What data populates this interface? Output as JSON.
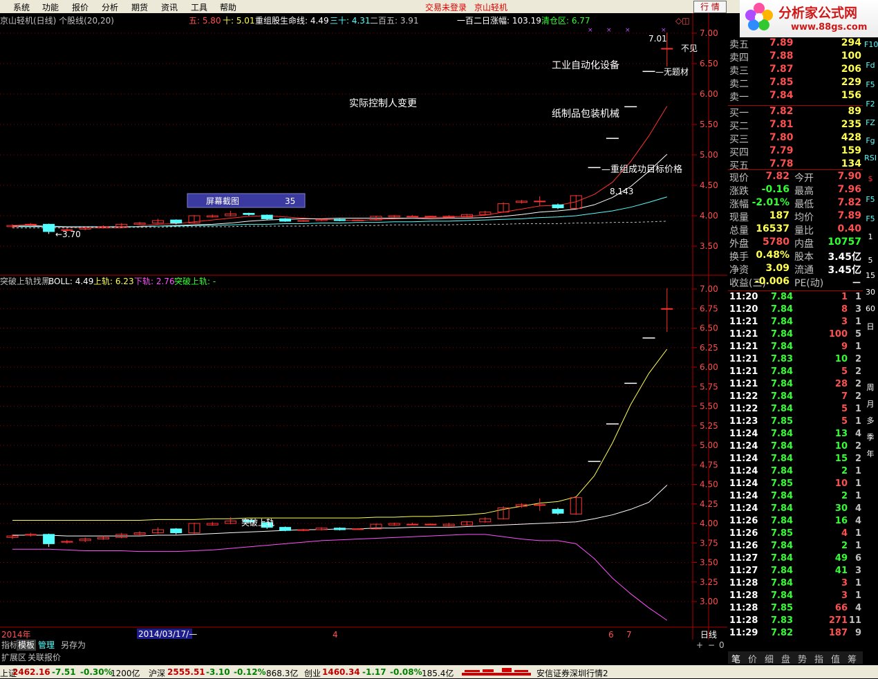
{
  "menu": {
    "items": [
      "系统",
      "功能",
      "报价",
      "分析",
      "期货",
      "资讯",
      "工具",
      "帮助"
    ],
    "login_status": "交易未登录",
    "stock_title": "京山轻机",
    "quote_button": "行 情"
  },
  "logo": {
    "text": "分析家公式网",
    "url": "www.88gs.com"
  },
  "top_panel": {
    "title": "京山轻机(日线) 个股线(20,20)",
    "ma5_label": "五: 5.80",
    "ma10_label": "十: 5.01",
    "line_label": "重组股生命线: 4.49",
    "ma30_label": "三十: 4.31",
    "ma250_label": "二百五: 3.91",
    "rise120": "一百二日涨幅: 103.19",
    "clear_zone": "清仓区: 6.77",
    "annotations": [
      "工业自动化设备",
      "实际控制人变更",
      "纸制品包装机械",
      "—重组成功目标价格",
      "—无题材",
      "不见"
    ],
    "high_label": "7.01",
    "low_label": "←3.70",
    "target_label": "8.143",
    "popup_label": "屏幕截图",
    "popup_value": "35",
    "axis_ticks": [
      "7.00",
      "6.50",
      "6.00",
      "5.50",
      "5.00",
      "4.50",
      "4.00",
      "3.50"
    ]
  },
  "bottom_panel": {
    "title": "突破上轨找黑",
    "boll_label": "BOLL: 4.49",
    "upper_label": "上轨: 6.23",
    "lower_label": "下轨: 2.76",
    "break_label": "突破上轨: -",
    "mark_text": "突破上轨",
    "axis_ticks": [
      "7.00",
      "6.75",
      "6.50",
      "6.25",
      "6.00",
      "5.75",
      "5.50",
      "5.25",
      "5.00",
      "4.75",
      "4.50",
      "4.25",
      "4.00",
      "3.75",
      "3.50",
      "3.25",
      "3.00"
    ]
  },
  "date_axis": {
    "year": "2014年",
    "cursor_date": "2014/03/17/—",
    "m4": "4",
    "m6": "6",
    "m7": "7",
    "period": "日线"
  },
  "bottom_tabs": [
    "指标",
    "模板",
    "管理",
    "另存为"
  ],
  "bottom_tabs2": [
    "扩展区",
    "关联报价"
  ],
  "zoom_controls": [
    "+",
    "−",
    "0"
  ],
  "quote": {
    "asks": [
      {
        "label": "卖五",
        "price": "7.89",
        "vol": "294"
      },
      {
        "label": "卖四",
        "price": "7.88",
        "vol": "100"
      },
      {
        "label": "卖三",
        "price": "7.87",
        "vol": "206"
      },
      {
        "label": "卖二",
        "price": "7.85",
        "vol": "229"
      },
      {
        "label": "卖一",
        "price": "7.84",
        "vol": "156"
      }
    ],
    "bids": [
      {
        "label": "买一",
        "price": "7.82",
        "vol": "89"
      },
      {
        "label": "买二",
        "price": "7.81",
        "vol": "235"
      },
      {
        "label": "买三",
        "price": "7.80",
        "vol": "428"
      },
      {
        "label": "买四",
        "price": "7.79",
        "vol": "159"
      },
      {
        "label": "买五",
        "price": "7.78",
        "vol": "134"
      }
    ],
    "stats": [
      {
        "l1": "现价",
        "v1": "7.82",
        "l2": "今开",
        "v2": "7.90"
      },
      {
        "l1": "涨跌",
        "v1": "-0.16",
        "l2": "最高",
        "v2": "7.96"
      },
      {
        "l1": "涨幅",
        "v1": "-2.01%",
        "l2": "最低",
        "v2": "7.82"
      },
      {
        "l1": "现量",
        "v1": "187",
        "l2": "均价",
        "v2": "7.89"
      },
      {
        "l1": "总量",
        "v1": "16537",
        "l2": "量比",
        "v2": "0.40"
      },
      {
        "l1": "外盘",
        "v1": "5780",
        "l2": "内盘",
        "v2": "10757"
      },
      {
        "l1": "换手",
        "v1": "0.48%",
        "l2": "股本",
        "v2": "3.45亿"
      },
      {
        "l1": "净资",
        "v1": "3.09",
        "l2": "流通",
        "v2": "3.45亿"
      },
      {
        "l1": "收益(三)",
        "v1": "-0.006",
        "l2": "PE(动)",
        "v2": "－"
      }
    ]
  },
  "trades": [
    [
      "11:20",
      "7.84",
      "1",
      "1"
    ],
    [
      "11:20",
      "7.84",
      "8",
      "3"
    ],
    [
      "11:21",
      "7.84",
      "3",
      "1"
    ],
    [
      "11:21",
      "7.84",
      "100",
      "5"
    ],
    [
      "11:21",
      "7.84",
      "9",
      "1"
    ],
    [
      "11:21",
      "7.83",
      "10",
      "2"
    ],
    [
      "11:21",
      "7.84",
      "5",
      "2"
    ],
    [
      "11:21",
      "7.84",
      "28",
      "2"
    ],
    [
      "11:22",
      "7.84",
      "7",
      "2"
    ],
    [
      "11:22",
      "7.84",
      "5",
      "1"
    ],
    [
      "11:23",
      "7.85",
      "5",
      "1"
    ],
    [
      "11:24",
      "7.84",
      "13",
      "4"
    ],
    [
      "11:24",
      "7.84",
      "10",
      "2"
    ],
    [
      "11:24",
      "7.84",
      "15",
      "2"
    ],
    [
      "11:24",
      "7.84",
      "2",
      "1"
    ],
    [
      "11:24",
      "7.85",
      "10",
      "1"
    ],
    [
      "11:24",
      "7.84",
      "2",
      "1"
    ],
    [
      "11:24",
      "7.84",
      "30",
      "4"
    ],
    [
      "11:26",
      "7.84",
      "16",
      "4"
    ],
    [
      "11:26",
      "7.85",
      "4",
      "1"
    ],
    [
      "11:26",
      "7.84",
      "2",
      "1"
    ],
    [
      "11:27",
      "7.84",
      "49",
      "6"
    ],
    [
      "11:27",
      "7.84",
      "41",
      "3"
    ],
    [
      "11:28",
      "7.84",
      "3",
      "1"
    ],
    [
      "11:28",
      "7.84",
      "3",
      "1"
    ],
    [
      "11:28",
      "7.85",
      "66",
      "4"
    ],
    [
      "11:28",
      "7.83",
      "271",
      "11"
    ],
    [
      "11:29",
      "7.82",
      "187",
      "9"
    ]
  ],
  "right_tabs": [
    "笔",
    "价",
    "细",
    "盘",
    "势",
    "指",
    "值",
    "筹"
  ],
  "side_tools": [
    "F10",
    "Fd",
    "F5",
    "F2",
    "FZ",
    "Fg",
    "RSI",
    "$",
    "F5",
    "F5",
    "1",
    "5",
    "15",
    "30",
    "60",
    "日",
    "周",
    "月",
    "多",
    "季",
    "年"
  ],
  "status": {
    "sh_label": "上证",
    "sh_val": "2462.16",
    "sh_chg": "-7.51",
    "sh_pct": "-0.30%",
    "sh_amt": "1200亿",
    "hs_label": "沪深",
    "hs_val": "2555.51",
    "hs_chg": "-3.10",
    "hs_pct": "-0.12%",
    "hs_amt": "868.3亿",
    "cy_label": "创业",
    "cy_val": "1460.34",
    "cy_chg": "-1.17",
    "cy_pct": "-0.08%",
    "cy_amt": "185.4亿",
    "broker": "安信证券深圳行情2"
  },
  "colors": {
    "up": "#ff3232",
    "down": "#54ffff",
    "bg": "#000000",
    "grid": "#8b0000",
    "ma5": "#ffffff",
    "ma10": "#ffff00",
    "ma30": "#ff00ff"
  },
  "chart_data": [
    {
      "type": "candlestick",
      "title": "京山轻机(日线) 个股线(20,20)",
      "ylim": [
        3.3,
        7.2
      ],
      "candles": [
        {
          "o": 3.82,
          "c": 3.84,
          "h": 3.86,
          "l": 3.8
        },
        {
          "o": 3.85,
          "c": 3.86,
          "h": 3.88,
          "l": 3.83
        },
        {
          "o": 3.86,
          "c": 3.74,
          "h": 3.87,
          "l": 3.7
        },
        {
          "o": 3.76,
          "c": 3.77,
          "h": 3.79,
          "l": 3.74
        },
        {
          "o": 3.78,
          "c": 3.8,
          "h": 3.82,
          "l": 3.76
        },
        {
          "o": 3.8,
          "c": 3.82,
          "h": 3.84,
          "l": 3.79
        },
        {
          "o": 3.82,
          "c": 3.86,
          "h": 3.88,
          "l": 3.81
        },
        {
          "o": 3.86,
          "c": 3.88,
          "h": 3.9,
          "l": 3.85
        },
        {
          "o": 3.88,
          "c": 3.92,
          "h": 3.95,
          "l": 3.87
        },
        {
          "o": 3.93,
          "c": 3.88,
          "h": 3.94,
          "l": 3.86
        },
        {
          "o": 3.88,
          "c": 4.0,
          "h": 4.01,
          "l": 3.87
        },
        {
          "o": 3.98,
          "c": 4.0,
          "h": 4.02,
          "l": 3.97
        },
        {
          "o": 4.0,
          "c": 4.03,
          "h": 4.08,
          "l": 3.99
        },
        {
          "o": 4.04,
          "c": 4.02,
          "h": 4.05,
          "l": 4.0
        },
        {
          "o": 4.01,
          "c": 3.95,
          "h": 4.02,
          "l": 3.93
        },
        {
          "o": 3.95,
          "c": 3.91,
          "h": 3.96,
          "l": 3.9
        },
        {
          "o": 3.91,
          "c": 3.92,
          "h": 3.93,
          "l": 3.9
        },
        {
          "o": 3.92,
          "c": 3.94,
          "h": 3.95,
          "l": 3.91
        },
        {
          "o": 3.94,
          "c": 3.92,
          "h": 3.95,
          "l": 3.91
        },
        {
          "o": 3.93,
          "c": 3.93,
          "h": 3.94,
          "l": 3.92
        },
        {
          "o": 3.93,
          "c": 3.99,
          "h": 4.0,
          "l": 3.92
        },
        {
          "o": 3.98,
          "c": 4.0,
          "h": 4.01,
          "l": 3.97
        },
        {
          "o": 3.99,
          "c": 3.99,
          "h": 4.01,
          "l": 3.98
        },
        {
          "o": 3.99,
          "c": 3.99,
          "h": 4.0,
          "l": 3.98
        },
        {
          "o": 3.97,
          "c": 3.99,
          "h": 4.01,
          "l": 3.96
        },
        {
          "o": 3.98,
          "c": 4.02,
          "h": 4.03,
          "l": 3.97
        },
        {
          "o": 4.02,
          "c": 4.06,
          "h": 4.08,
          "l": 4.01
        },
        {
          "o": 4.06,
          "c": 4.2,
          "h": 4.22,
          "l": 4.05
        },
        {
          "o": 4.22,
          "c": 4.24,
          "h": 4.26,
          "l": 4.2
        },
        {
          "o": 4.24,
          "c": 4.24,
          "h": 4.32,
          "l": 4.16
        },
        {
          "o": 4.18,
          "c": 4.13,
          "h": 4.2,
          "l": 4.11
        },
        {
          "o": 4.12,
          "c": 4.33,
          "h": 4.34,
          "l": 4.11
        },
        {
          "o": 4.8,
          "c": 4.8,
          "h": 4.8,
          "l": 4.8
        },
        {
          "o": 5.28,
          "c": 5.28,
          "h": 5.28,
          "l": 5.28
        },
        {
          "o": 5.8,
          "c": 5.8,
          "h": 5.8,
          "l": 5.8
        },
        {
          "o": 6.38,
          "c": 6.38,
          "h": 6.38,
          "l": 6.38
        },
        {
          "o": 6.75,
          "c": 6.75,
          "h": 7.01,
          "l": 6.45
        }
      ],
      "series": [
        {
          "name": "五",
          "values": [
            3.84,
            3.85,
            3.82,
            3.81,
            3.8,
            3.8,
            3.8,
            3.83,
            3.86,
            3.87,
            3.9,
            3.93,
            3.96,
            3.99,
            4.0,
            3.98,
            3.96,
            3.94,
            3.93,
            3.92,
            3.94,
            3.95,
            3.96,
            3.97,
            3.98,
            3.99,
            4.01,
            4.06,
            4.11,
            4.16,
            4.17,
            4.23,
            4.35,
            4.55,
            4.89,
            5.31,
            5.8
          ]
        },
        {
          "name": "十",
          "values": [
            3.83,
            3.83,
            3.83,
            3.82,
            3.82,
            3.82,
            3.82,
            3.82,
            3.83,
            3.84,
            3.85,
            3.86,
            3.88,
            3.91,
            3.93,
            3.94,
            3.95,
            3.95,
            3.96,
            3.96,
            3.96,
            3.96,
            3.96,
            3.95,
            3.96,
            3.96,
            3.97,
            3.99,
            4.02,
            4.06,
            4.08,
            4.11,
            4.18,
            4.3,
            4.48,
            4.73,
            5.01
          ]
        },
        {
          "name": "三十",
          "values": [
            3.82,
            3.82,
            3.82,
            3.82,
            3.82,
            3.82,
            3.82,
            3.82,
            3.83,
            3.83,
            3.84,
            3.84,
            3.85,
            3.86,
            3.86,
            3.87,
            3.87,
            3.88,
            3.88,
            3.89,
            3.89,
            3.9,
            3.9,
            3.91,
            3.91,
            3.92,
            3.93,
            3.94,
            3.95,
            3.97,
            3.98,
            4.0,
            4.04,
            4.08,
            4.14,
            4.22,
            4.31
          ]
        },
        {
          "name": "二百五",
          "values": [
            3.8,
            3.8,
            3.8,
            3.8,
            3.81,
            3.81,
            3.81,
            3.81,
            3.81,
            3.82,
            3.82,
            3.82,
            3.82,
            3.83,
            3.83,
            3.83,
            3.83,
            3.84,
            3.84,
            3.84,
            3.84,
            3.85,
            3.85,
            3.85,
            3.85,
            3.86,
            3.86,
            3.86,
            3.87,
            3.87,
            3.87,
            3.88,
            3.88,
            3.89,
            3.89,
            3.9,
            3.91
          ]
        }
      ]
    },
    {
      "type": "line",
      "title": "突破上轨找黑",
      "ylim": [
        2.7,
        7.1
      ],
      "series": [
        {
          "name": "BOLL",
          "values": [
            3.85,
            3.85,
            3.85,
            3.84,
            3.84,
            3.84,
            3.84,
            3.84,
            3.85,
            3.85,
            3.86,
            3.87,
            3.88,
            3.89,
            3.9,
            3.91,
            3.92,
            3.92,
            3.93,
            3.93,
            3.94,
            3.94,
            3.95,
            3.95,
            3.95,
            3.96,
            3.97,
            3.98,
            3.99,
            4.0,
            4.01,
            4.02,
            4.06,
            4.11,
            4.18,
            4.27,
            4.49
          ]
        },
        {
          "name": "上轨",
          "values": [
            4.04,
            4.04,
            4.04,
            4.04,
            4.04,
            4.04,
            4.04,
            4.04,
            4.05,
            4.05,
            4.05,
            4.06,
            4.06,
            4.07,
            4.07,
            4.07,
            4.07,
            4.07,
            4.07,
            4.07,
            4.08,
            4.08,
            4.09,
            4.09,
            4.1,
            4.11,
            4.13,
            4.18,
            4.22,
            4.26,
            4.28,
            4.34,
            4.61,
            5.03,
            5.52,
            5.92,
            6.23
          ]
        },
        {
          "name": "下轨",
          "values": [
            3.67,
            3.67,
            3.67,
            3.66,
            3.65,
            3.65,
            3.65,
            3.64,
            3.64,
            3.64,
            3.65,
            3.66,
            3.68,
            3.7,
            3.72,
            3.74,
            3.76,
            3.78,
            3.79,
            3.8,
            3.81,
            3.82,
            3.83,
            3.84,
            3.85,
            3.86,
            3.86,
            3.83,
            3.8,
            3.78,
            3.78,
            3.74,
            3.55,
            3.3,
            3.1,
            2.92,
            2.76
          ]
        }
      ]
    }
  ]
}
